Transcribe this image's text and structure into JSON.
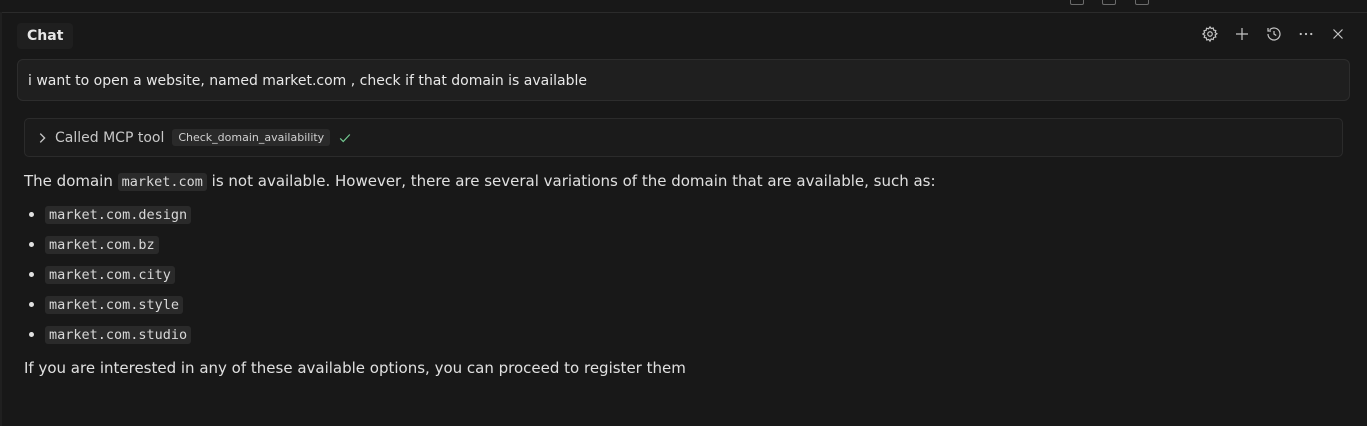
{
  "header": {
    "title": "Chat",
    "actions": [
      {
        "name": "settings",
        "icon": "gear-icon"
      },
      {
        "name": "new-chat",
        "icon": "plus-icon"
      },
      {
        "name": "history",
        "icon": "history-icon"
      },
      {
        "name": "more",
        "icon": "ellipsis-icon"
      },
      {
        "name": "close",
        "icon": "close-icon"
      }
    ]
  },
  "user_message": "i want to open a website, named market.com , check if that domain is available",
  "tool_call": {
    "label": "Called MCP tool",
    "tool_name": "Check_domain_availability",
    "status": "success"
  },
  "response": {
    "intro_before": "The domain ",
    "intro_code": "market.com",
    "intro_after": " is not available. However, there are several variations of the domain that are available, such as:",
    "domains": [
      "market.com.design",
      "market.com.bz",
      "market.com.city",
      "market.com.style",
      "market.com.studio"
    ],
    "outro": "If you are interested in any of these available options, you can proceed to register them"
  },
  "colors": {
    "background": "#181818",
    "panel": "#1f1f1f",
    "check": "#73c991"
  }
}
